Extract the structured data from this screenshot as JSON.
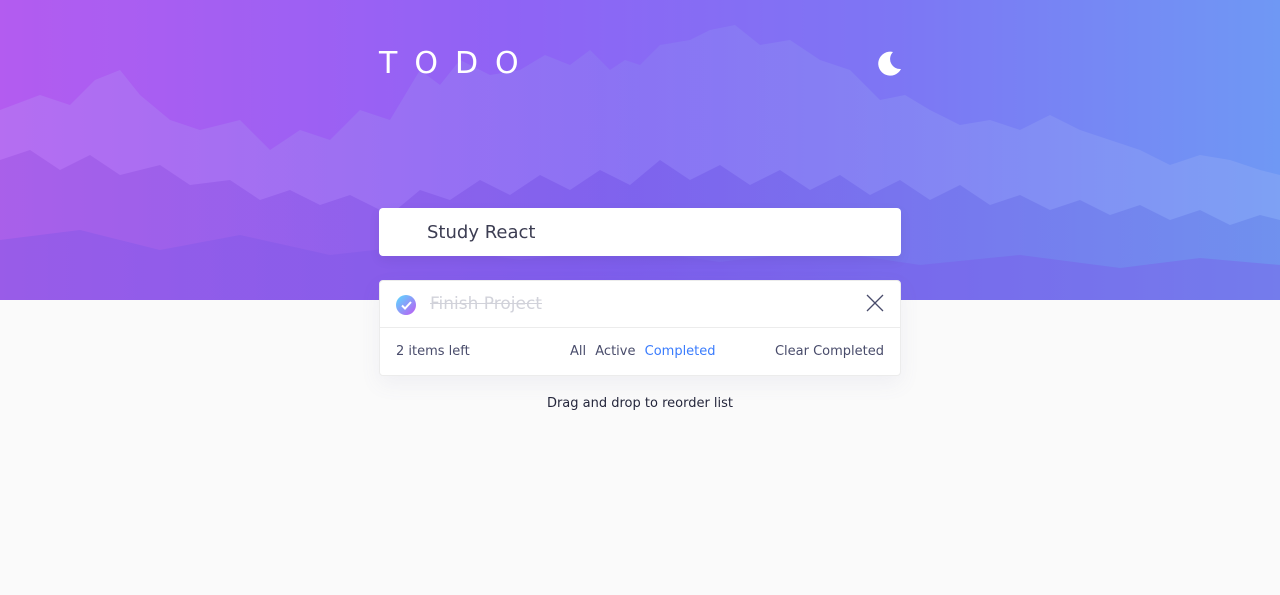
{
  "app": {
    "title": "TODO",
    "theme_icon": "moon-icon"
  },
  "new_todo": {
    "value": "Study React"
  },
  "todos": [
    {
      "text": "Finish Project",
      "completed": true
    }
  ],
  "footer": {
    "items_left": "2 items left",
    "filters": [
      "All",
      "Active",
      "Completed"
    ],
    "active_filter": "Completed",
    "clear_label": "Clear Completed"
  },
  "hint": "Drag and drop to reorder list",
  "colors": {
    "accent": "#3a7cfd",
    "check_gradient_start": "#57ddff",
    "check_gradient_end": "#c058f3"
  }
}
